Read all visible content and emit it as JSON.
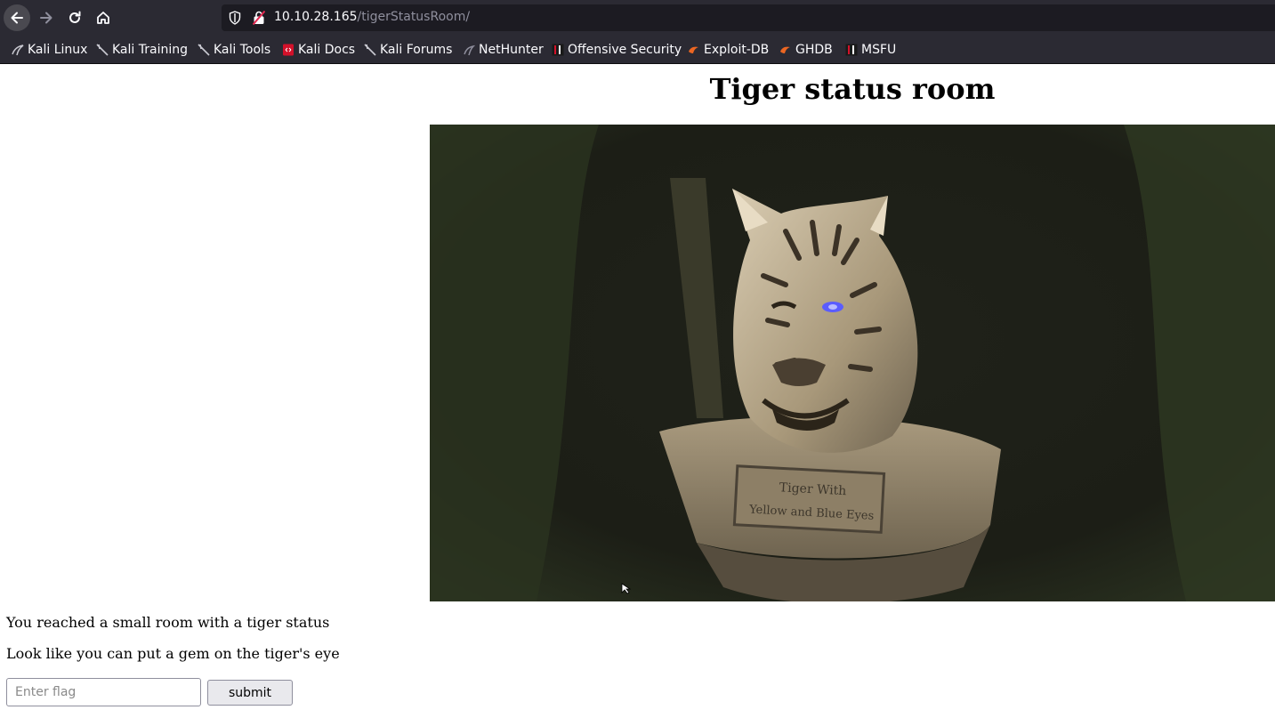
{
  "browser": {
    "url_host": "10.10.28.165",
    "url_path": "/tigerStatusRoom/",
    "bookmarks": [
      {
        "label": "Kali Linux",
        "icon": "kali-dragon-icon"
      },
      {
        "label": "Kali Training",
        "icon": "kali-dragon-icon"
      },
      {
        "label": "Kali Tools",
        "icon": "kali-dragon-icon"
      },
      {
        "label": "Kali Docs",
        "icon": "kali-docs-icon"
      },
      {
        "label": "Kali Forums",
        "icon": "kali-dragon-icon"
      },
      {
        "label": "NetHunter",
        "icon": "nethunter-icon"
      },
      {
        "label": "Offensive Security",
        "icon": "offsec-icon"
      },
      {
        "label": "Exploit-DB",
        "icon": "exploit-db-icon"
      },
      {
        "label": "GHDB",
        "icon": "ghdb-icon"
      },
      {
        "label": "MSFU",
        "icon": "offsec-icon"
      }
    ]
  },
  "page": {
    "title": "Tiger status room",
    "line1": "You reached a small room with a tiger status",
    "line2": "Look like you can put a gem on the tiger's eye",
    "flag_placeholder": "Enter flag",
    "submit_label": "submit",
    "image_plaque_text": [
      "Tiger With",
      "Yellow and Blue Eyes"
    ]
  },
  "colors": {
    "chrome_bg": "#2b2a33",
    "urlbar_bg": "#1c1b22",
    "tiger_eye": "#5a5cff"
  }
}
